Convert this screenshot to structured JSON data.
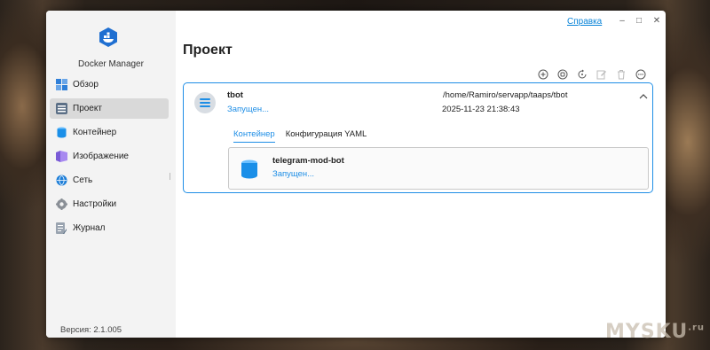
{
  "app": {
    "name": "Docker Manager",
    "version": "Версия: 2.1.005"
  },
  "window": {
    "help": "Справка",
    "minimize": "–",
    "maximize": "□",
    "close": "✕"
  },
  "sidebar": {
    "items": [
      {
        "label": "Обзор",
        "icon": "overview-icon"
      },
      {
        "label": "Проект",
        "icon": "project-icon",
        "active": true
      },
      {
        "label": "Контейнер",
        "icon": "container-icon"
      },
      {
        "label": "Изображение",
        "icon": "image-icon"
      },
      {
        "label": "Сеть",
        "icon": "network-icon"
      },
      {
        "label": "Настройки",
        "icon": "settings-icon"
      },
      {
        "label": "Журнал",
        "icon": "log-icon"
      }
    ]
  },
  "main": {
    "title": "Проект",
    "toolbar": [
      "add-icon",
      "stop-icon",
      "restart-icon",
      "edit-icon",
      "delete-icon",
      "more-icon"
    ],
    "project": {
      "name": "tbot",
      "status": "Запущен...",
      "path": "/home/Ramiro/servapp/taaps/tbot",
      "created": "2025-11-23 21:38:43",
      "tabs": [
        "Контейнер",
        "Конфигурация YAML"
      ],
      "container": {
        "name": "telegram-mod-bot",
        "status": "Запущен..."
      }
    }
  },
  "watermark": {
    "text": "MYSKU",
    "suffix": ".ru"
  },
  "colors": {
    "accent": "#1e8ee6",
    "sidebar_bg": "#f3f3f3"
  }
}
